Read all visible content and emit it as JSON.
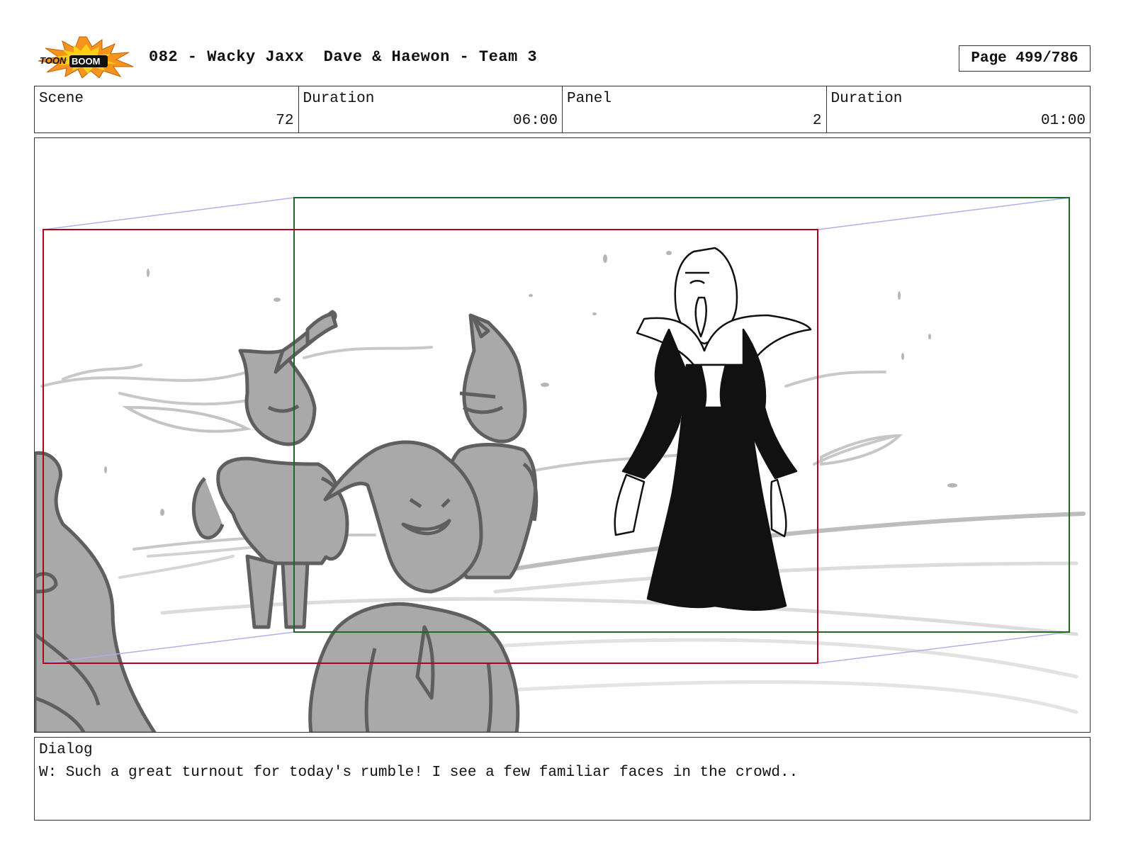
{
  "header": {
    "logo": {
      "icon": "toonboom-logo-icon",
      "text": "TOONBOOM",
      "color_burst": "#f7941d",
      "color_inner": "#fcd116"
    },
    "title": "082 - Wacky Jaxx  Dave & Haewon - Team 3",
    "page": "Page 499/786"
  },
  "info": {
    "scene_label": "Scene",
    "scene_value": "72",
    "scene_duration_label": "Duration",
    "scene_duration_value": "06:00",
    "panel_label": "Panel",
    "panel_value": "2",
    "panel_duration_label": "Duration",
    "panel_duration_value": "01:00"
  },
  "panel": {
    "camera_frame_start_color": "#b3001b",
    "camera_frame_end_color": "#1a6b1a",
    "camera_move_color": "#b0b0e8",
    "sketch_gray": "#a9a9a9",
    "sketch_line": "#5a5a5a"
  },
  "dialog": {
    "label": "Dialog",
    "text": "W: Such a great turnout for today's rumble! I see a few familiar faces in the crowd.."
  }
}
